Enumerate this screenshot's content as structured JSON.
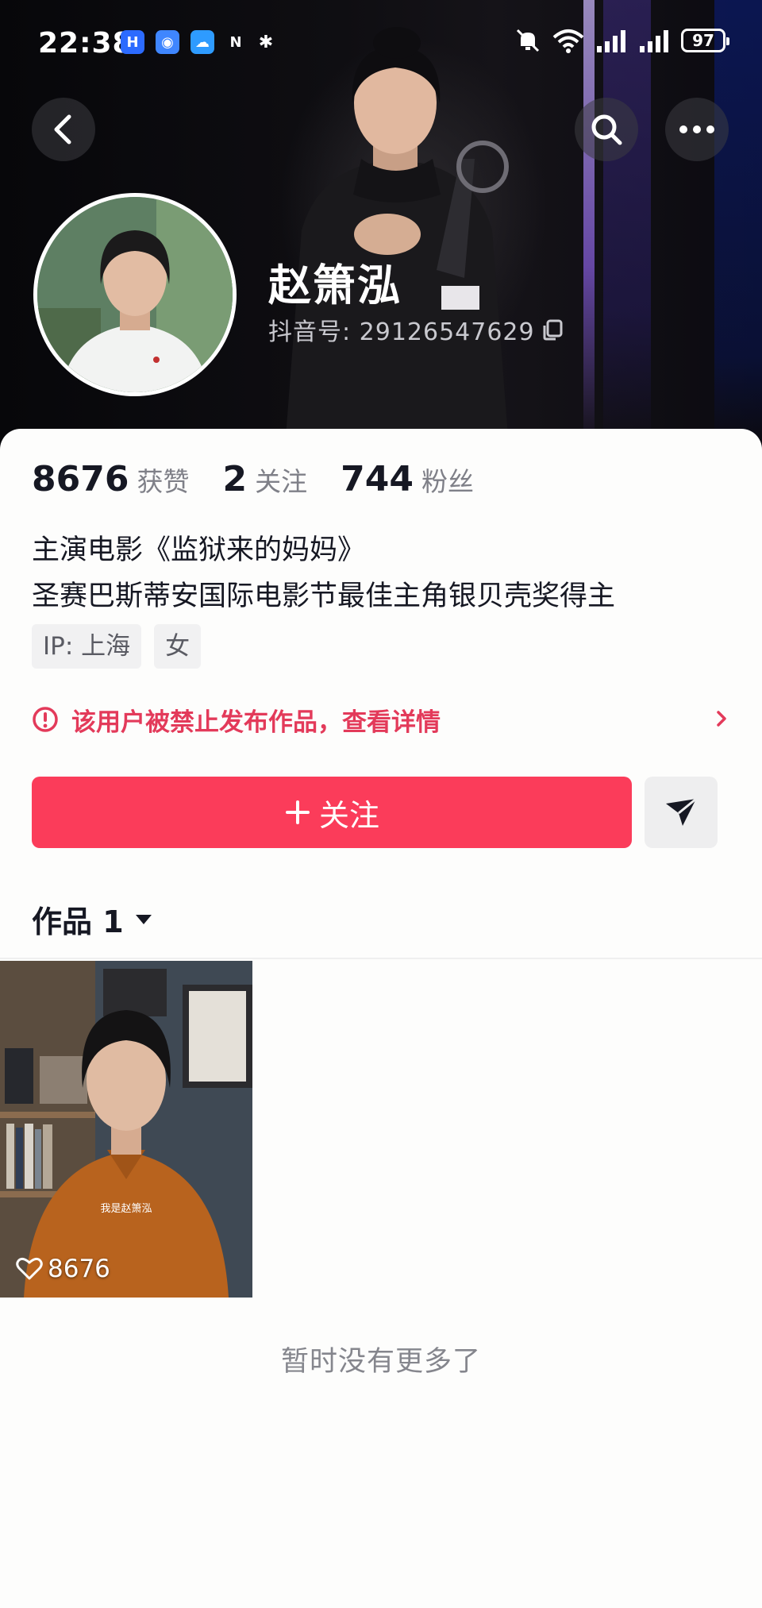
{
  "status_bar": {
    "time": "22:38",
    "battery": "97",
    "icons": [
      "notification-app-icon",
      "location-app-icon",
      "weather-app-icon",
      "nfc-icon",
      "bluetooth-icon",
      "mute-icon",
      "wifi-icon",
      "signal-icon",
      "signal-icon"
    ]
  },
  "header": {
    "back_icon": "chevron-left-icon",
    "search_icon": "search-icon",
    "more_icon": "more-dots-icon"
  },
  "profile": {
    "nickname": "赵箫泓",
    "douyin_id": "抖音号: 29126547629",
    "copy_icon": "copy-icon"
  },
  "stats": [
    {
      "value": "8676",
      "label": "获赞"
    },
    {
      "value": "2",
      "label": "关注"
    },
    {
      "value": "744",
      "label": "粉丝"
    }
  ],
  "bio": {
    "line1": "主演电影《监狱来的妈妈》",
    "line2": "圣赛巴斯蒂安国际电影节最佳主角银贝壳奖得主"
  },
  "tags": [
    "IP: 上海",
    "女"
  ],
  "ban_notice": {
    "text": "该用户被禁止发布作品，查看详情",
    "color": "#e33a5a"
  },
  "actions": {
    "follow_label": "关注",
    "follow_color": "#fb3c5a"
  },
  "works": {
    "tab_label": "作品 1",
    "items": [
      {
        "likes": "8676",
        "caption": "我是赵箫泓"
      }
    ],
    "end_text": "暂时没有更多了"
  }
}
